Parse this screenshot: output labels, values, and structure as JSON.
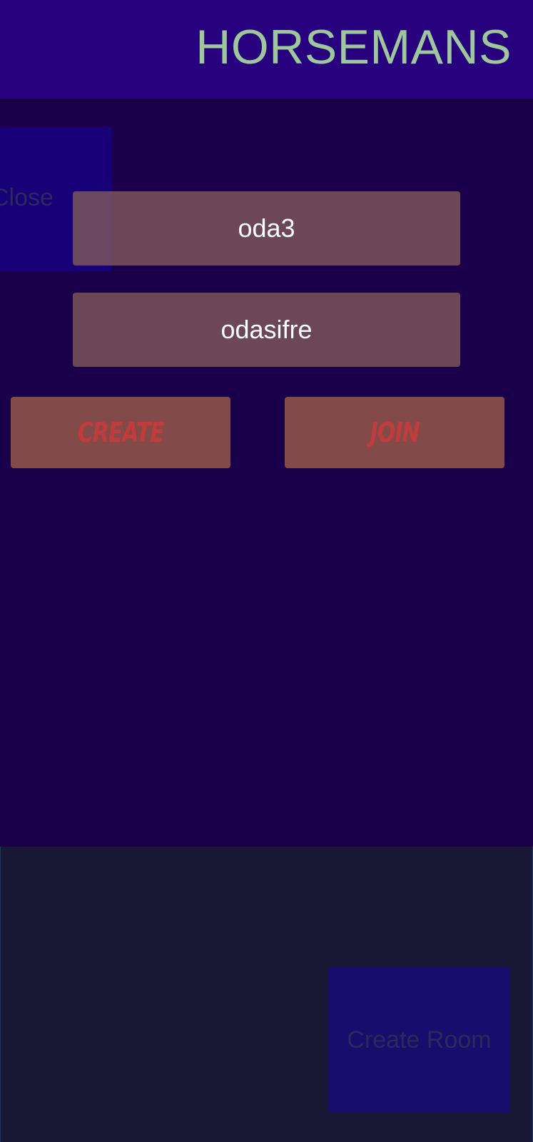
{
  "header": {
    "title": "HORSEMANS"
  },
  "close_button": {
    "label": "Close"
  },
  "room_name_field": {
    "value": "oda3"
  },
  "room_password_field": {
    "value": "odasifre"
  },
  "actions": {
    "create_label": "CREATE",
    "join_label": "JOIN"
  },
  "create_room_button": {
    "label": "Create Room"
  },
  "colors": {
    "header_bg": "#27017e",
    "title": "#9fc79c",
    "main_bg": "#1a004b",
    "bottom_bg": "#181734",
    "field_bg": "#8c645a",
    "action_bg": "#824a48",
    "action_text": "#c23c3c",
    "blue_button": "#180178"
  }
}
